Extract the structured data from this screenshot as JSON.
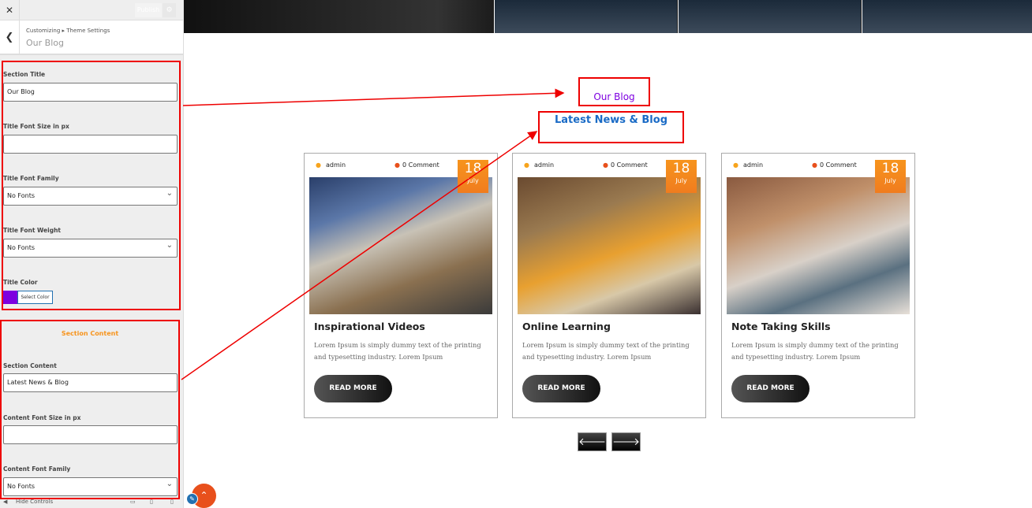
{
  "sidebar": {
    "publish_label": "Publish",
    "breadcrumb": "Customizing ▸ Theme Settings",
    "panel_title": "Our Blog",
    "fields": {
      "section_title_label": "Section Title",
      "section_title_value": "Our Blog",
      "title_font_size_label": "Title Font Size in px",
      "title_font_size_value": "",
      "title_font_family_label": "Title Font Family",
      "title_font_family_value": "No Fonts",
      "title_font_weight_label": "Title Font Weight",
      "title_font_weight_value": "No Fonts",
      "title_color_label": "Title Color",
      "title_color_value": "#7d00e0",
      "select_color_label": "Select Color",
      "section_content_heading": "Section Content",
      "section_content_label": "Section Content",
      "section_content_value": "Latest News & Blog",
      "content_font_size_label": "Content Font Size in px",
      "content_font_size_value": "",
      "content_font_family_label": "Content Font Family",
      "content_font_family_value": "No Fonts"
    },
    "hide_controls": "Hide Controls"
  },
  "preview": {
    "section_title": "Our Blog",
    "section_content": "Latest News & Blog",
    "cards": [
      {
        "author": "admin",
        "comments": "0 Comment",
        "day": "18",
        "month": "July",
        "title": "Inspirational Videos",
        "excerpt": "Lorem Ipsum is simply dummy text of the printing and typesetting industry. Lorem Ipsum",
        "button": "READ MORE"
      },
      {
        "author": "admin",
        "comments": "0 Comment",
        "day": "18",
        "month": "July",
        "title": "Online Learning",
        "excerpt": "Lorem Ipsum is simply dummy text of the printing and typesetting industry. Lorem Ipsum",
        "button": "READ MORE"
      },
      {
        "author": "admin",
        "comments": "0 Comment",
        "day": "18",
        "month": "July",
        "title": "Note Taking Skills",
        "excerpt": "Lorem Ipsum is simply dummy text of the printing and typesetting industry. Lorem Ipsum",
        "button": "READ MORE"
      }
    ],
    "prev": "🡐",
    "next": "🡒"
  },
  "colors": {
    "accent": "#f7941d",
    "annotation": "#e00000",
    "title": "#7d00e0",
    "content": "#1a6bc6"
  }
}
